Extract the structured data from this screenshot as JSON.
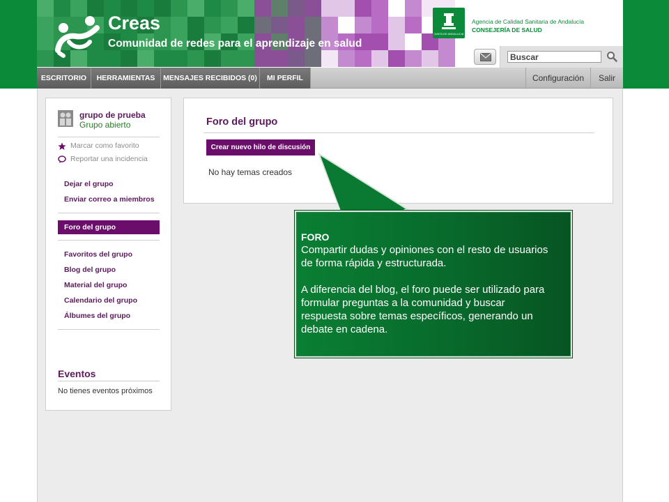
{
  "header": {
    "brand_title": "Creas",
    "brand_subtitle": "Comunidad de redes para el aprendizaje en salud",
    "agency_line1": "Agencia de Calidad Sanitaria de Andalucía",
    "agency_line2": "CONSEJERÍA DE SALUD",
    "seal_text": "JUNTA DE ANDALUCIA",
    "search_placeholder": "Buscar",
    "mail_icon": "envelope-icon",
    "search_icon": "magnifier-icon"
  },
  "nav": {
    "tabs": [
      "ESCRITORIO",
      "HERRAMIENTAS",
      "MENSAJES RECIBIDOS (0)",
      "MI PERFIL"
    ],
    "right": [
      "Configuración",
      "Salir"
    ]
  },
  "sidebar": {
    "group_name": "grupo de prueba",
    "group_status": "Grupo abierto",
    "actions": [
      {
        "label": "Marcar como favorito",
        "icon": "star-icon"
      },
      {
        "label": "Reportar una incidencia",
        "icon": "speech-bubble-icon"
      }
    ],
    "links_top": [
      "Dejar el grupo",
      "Enviar correo a miembros"
    ],
    "active_item": "Foro del grupo",
    "links_bottom": [
      "Favoritos del grupo",
      "Blog del grupo",
      "Material del grupo",
      "Calendario del grupo",
      "Álbumes del grupo"
    ],
    "events_title": "Eventos",
    "events_empty": "No tienes eventos próximos"
  },
  "main": {
    "title": "Foro del grupo",
    "new_thread_button": "Crear nuevo hilo de discusión",
    "empty_text": "No hay temas creados"
  },
  "callout": {
    "heading": "FORO",
    "lines": [
      "Compartir dudas y opiniones con el resto de usuarios",
      "de forma rápida y estructurada.",
      "A diferencia del blog, el foro puede ser utilizado para",
      "formular preguntas a la comunidad y buscar",
      "respuesta sobre temas específicos, generando un",
      "debate en cadena."
    ]
  },
  "colors": {
    "brand_green": "#0b8a3a",
    "brand_purple": "#6b0d6b",
    "callout_green": "#086a2c"
  }
}
